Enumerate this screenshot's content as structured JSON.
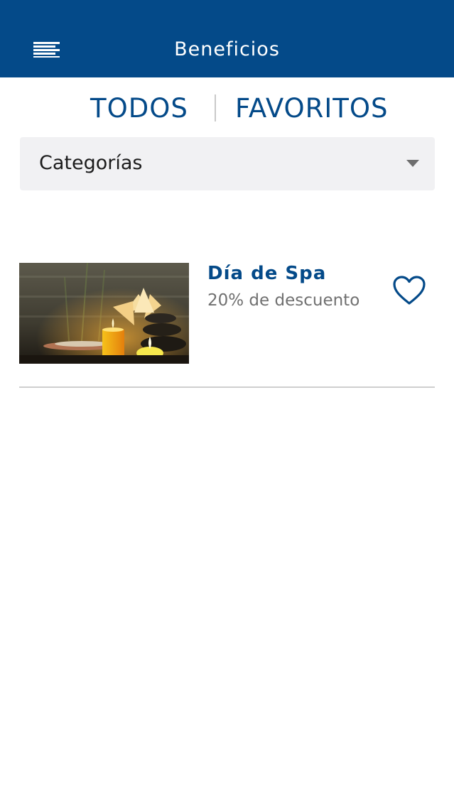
{
  "header": {
    "title": "Beneficios",
    "menu_icon": "menu-lines-icon"
  },
  "tabs": [
    {
      "label": "TODOS"
    },
    {
      "label": "FAVORITOS"
    }
  ],
  "filter": {
    "selected": "Categorías",
    "icon": "chevron-down-icon"
  },
  "benefits": [
    {
      "title": "Día de Spa",
      "subtitle": "20% de descuento",
      "favorite_icon": "heart-outline-icon"
    }
  ],
  "colors": {
    "primary": "#044a89",
    "header_text": "#ffffff",
    "subtitle_text": "#707070",
    "select_bg": "#f1f1f3",
    "divider": "#cfcfcf"
  }
}
